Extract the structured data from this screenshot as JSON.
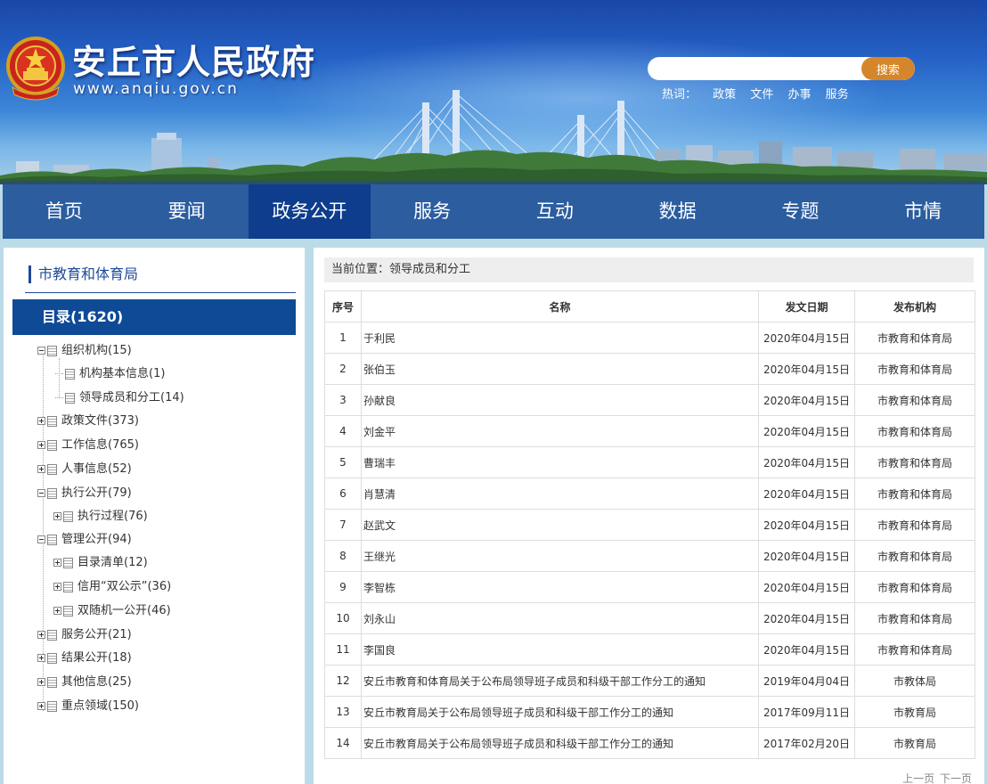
{
  "header": {
    "site_title": "安丘市人民政府",
    "site_url": "www.anqiu.gov.cn",
    "search": {
      "placeholder": "",
      "button_label": "搜索"
    },
    "hotwords_label": "热词：",
    "hotwords": [
      "政策",
      "文件",
      "办事",
      "服务"
    ]
  },
  "nav": {
    "items": [
      "首页",
      "要闻",
      "政务公开",
      "服务",
      "互动",
      "数据",
      "专题",
      "市情"
    ],
    "active_index": 2
  },
  "sidebar": {
    "title": "市教育和体育局",
    "catalog": "目录(1620)",
    "tree": [
      {
        "label": "组织机构(15)",
        "level": 0,
        "toggle": "minus"
      },
      {
        "label": "机构基本信息(1)",
        "level": 1,
        "toggle": "none"
      },
      {
        "label": "领导成员和分工(14)",
        "level": 1,
        "toggle": "none",
        "selected": true
      },
      {
        "label": "政策文件(373)",
        "level": 0,
        "toggle": "plus"
      },
      {
        "label": "工作信息(765)",
        "level": 0,
        "toggle": "plus"
      },
      {
        "label": "人事信息(52)",
        "level": 0,
        "toggle": "plus"
      },
      {
        "label": "执行公开(79)",
        "level": 0,
        "toggle": "minus"
      },
      {
        "label": "执行过程(76)",
        "level": 1,
        "toggle": "plus"
      },
      {
        "label": "管理公开(94)",
        "level": 0,
        "toggle": "minus"
      },
      {
        "label": "目录清单(12)",
        "level": 1,
        "toggle": "plus"
      },
      {
        "label": "信用“双公示”(36)",
        "level": 1,
        "toggle": "plus"
      },
      {
        "label": "双随机一公开(46)",
        "level": 1,
        "toggle": "plus"
      },
      {
        "label": "服务公开(21)",
        "level": 0,
        "toggle": "plus"
      },
      {
        "label": "结果公开(18)",
        "level": 0,
        "toggle": "plus"
      },
      {
        "label": "其他信息(25)",
        "level": 0,
        "toggle": "plus"
      },
      {
        "label": "重点领域(150)",
        "level": 0,
        "toggle": "plus"
      }
    ]
  },
  "main": {
    "breadcrumb": "当前位置：领导成员和分工",
    "columns": [
      "序号",
      "名称",
      "发文日期",
      "发布机构"
    ],
    "rows": [
      [
        "1",
        "于利民",
        "2020年04月15日",
        "市教育和体育局"
      ],
      [
        "2",
        "张伯玉",
        "2020年04月15日",
        "市教育和体育局"
      ],
      [
        "3",
        "孙献良",
        "2020年04月15日",
        "市教育和体育局"
      ],
      [
        "4",
        "刘金平",
        "2020年04月15日",
        "市教育和体育局"
      ],
      [
        "5",
        "曹瑞丰",
        "2020年04月15日",
        "市教育和体育局"
      ],
      [
        "6",
        "肖慧清",
        "2020年04月15日",
        "市教育和体育局"
      ],
      [
        "7",
        "赵武文",
        "2020年04月15日",
        "市教育和体育局"
      ],
      [
        "8",
        "王继光",
        "2020年04月15日",
        "市教育和体育局"
      ],
      [
        "9",
        "李智栋",
        "2020年04月15日",
        "市教育和体育局"
      ],
      [
        "10",
        "刘永山",
        "2020年04月15日",
        "市教育和体育局"
      ],
      [
        "11",
        "李国良",
        "2020年04月15日",
        "市教育和体育局"
      ],
      [
        "12",
        "安丘市教育和体育局关于公布局领导班子成员和科级干部工作分工的通知",
        "2019年04月04日",
        "市教体局"
      ],
      [
        "13",
        "安丘市教育局关于公布局领导班子成员和科级干部工作分工的通知",
        "2017年09月11日",
        "市教育局"
      ],
      [
        "14",
        "安丘市教育局关于公布局领导班子成员和科级干部工作分工的通知",
        "2017年02月20日",
        "市教育局"
      ]
    ],
    "pager": {
      "prev": "上一页",
      "next": "下一页"
    }
  },
  "colors": {
    "nav_bg": "#2b5d9f",
    "nav_active": "#0d3d8c",
    "accent_blue": "#1d4a9a",
    "search_button": "#d6862a"
  }
}
